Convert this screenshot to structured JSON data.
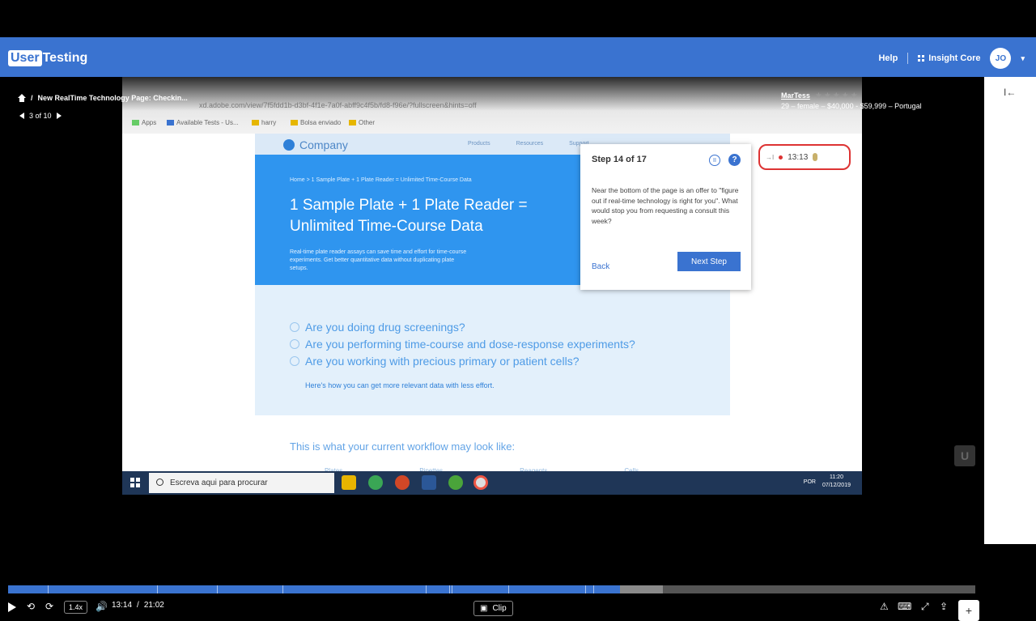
{
  "header": {
    "logo_box": "User",
    "logo_rest": "Testing",
    "help": "Help",
    "insight_core": "Insight Core",
    "avatar": "JO",
    "avatar_caret": "▾"
  },
  "session": {
    "breadcrumb_sep": "/",
    "title": "New RealTime Technology Page: Checkin...",
    "position": "3 of 10",
    "tester_name": "MarTess",
    "stars": "★★★★★",
    "tester_info": "29 – female – $40,000 - $59,999 – Portugal"
  },
  "browser": {
    "url": "xd.adobe.com/view/7f5fdd1b-d3bf-4f1e-7a0f-abff9c4f5b/fd8-f96e/?fullscreen&hints=off",
    "bookmarks": [
      "Apps",
      "Available Tests - Us...",
      "harry",
      "Bolsa enviado",
      "Other"
    ]
  },
  "site": {
    "logo": "Company",
    "nav": [
      "Products",
      "Resources",
      "Support"
    ],
    "breadcrumb": "Home  >  1 Sample Plate + 1 Plate Reader = Unlimited Time-Course Data",
    "hero_title": "1 Sample Plate + 1 Plate Reader = Unlimited Time-Course Data",
    "hero_sub": "Real-time plate reader assays can save time and effort for time-course experiments. Get better quantitative data without duplicating plate setups.",
    "questions": [
      "Are you doing drug screenings?",
      "Are you performing time-course and dose-response experiments?",
      "Are you working with precious primary or patient cells?"
    ],
    "link": "Here's how you can get more relevant data with less effort.",
    "workflow": "This is what your current workflow may look like:",
    "workflow_labels": [
      "Plates",
      "Pipettes",
      "Reagents",
      "Cells"
    ]
  },
  "step": {
    "title": "Step 14 of 17",
    "pause": "II",
    "help": "?",
    "text": "Near the bottom of the page is an offer to \"figure out if real-time technology is right for you\". What would stop you from requesting a consult this week?",
    "back": "Back",
    "next": "Next Step"
  },
  "recorder": {
    "collapse_icon": "→I",
    "time": "13:13"
  },
  "taskbar": {
    "search": "Escreva aqui para procurar",
    "lang": "POR",
    "time": "11:20",
    "date": "07/12/2019"
  },
  "player": {
    "current": "13:14",
    "separator": "/",
    "total": "21:02",
    "speed": "1.4x",
    "clip": "Clip",
    "progress": 0.633,
    "buffered": 0.677,
    "plus": "+"
  },
  "sidebar": {
    "collapse": "I←"
  },
  "colors": {
    "brand": "#3a73d0",
    "recording": "#dd3333"
  }
}
